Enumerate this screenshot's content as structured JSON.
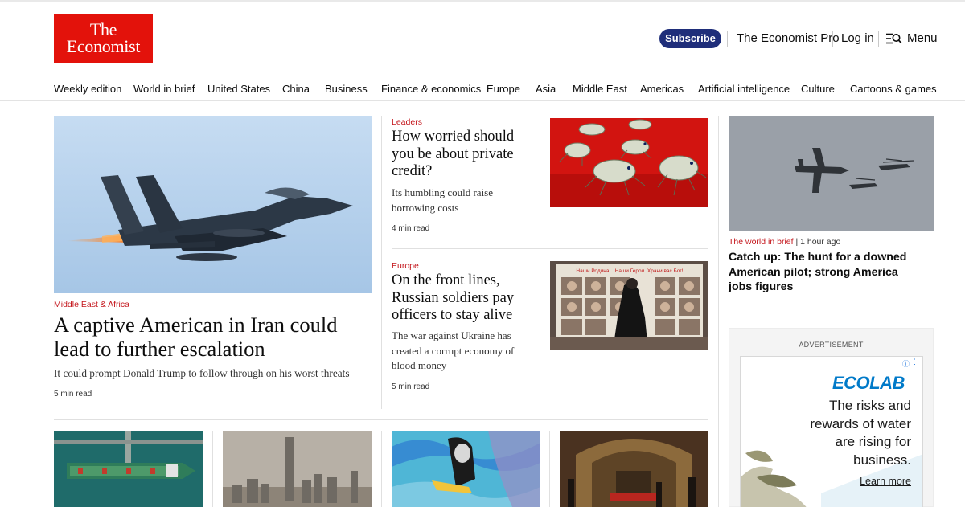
{
  "header": {
    "logo_line1": "The",
    "logo_line2": "Economist",
    "subscribe": "Subscribe",
    "pro": "The Economist Pro",
    "login": "Log in",
    "menu": "Menu"
  },
  "nav": [
    "Weekly edition",
    "World in brief",
    "United States",
    "China",
    "Business",
    "Finance & economics",
    "Europe",
    "Asia",
    "Middle East",
    "Americas",
    "Artificial intelligence",
    "Culture",
    "Cartoons & games"
  ],
  "lead": {
    "kicker": "Middle East & Africa",
    "headline_line1": "A captive American in Iran could",
    "headline_line2": "lead to further escalation",
    "dek": "It could prompt Donald Trump to follow through on his worst threats",
    "read": "5 min read"
  },
  "story2": {
    "kicker": "Leaders",
    "headline_line1": "How worried should",
    "headline_line2": "you be about private",
    "headline_line3": "credit?",
    "dek_line1": "Its humbling could raise",
    "dek_line2": "borrowing costs",
    "read": "4 min read"
  },
  "story3": {
    "kicker": "Europe",
    "headline_line1": "On the front lines,",
    "headline_line2": "Russian soldiers pay",
    "headline_line3": "officers to stay alive",
    "dek_line1": "The war against Ukraine has",
    "dek_line2": "created a corrupt economy of",
    "dek_line3": "blood money",
    "read": "5 min read",
    "billboard_text": "Наши Родина!.. Наши Герои. Храни вас Бог!"
  },
  "brief": {
    "kicker": "The world in brief",
    "time": "1 hour ago",
    "headline": "Catch up: The hunt for a downed American pilot; strong America jobs figures"
  },
  "ad": {
    "label": "ADVERTISEMENT",
    "brand": "ECOLAB",
    "text": "The risks and rewards of water are rising for business.",
    "cta": "Learn more"
  },
  "colors": {
    "brand_red": "#e3120b",
    "kicker_red": "#c4161c",
    "subscribe_navy": "#1f2e7a",
    "ad_blue": "#007ac9"
  },
  "icons": [
    "search-menu-icon",
    "ad-info-icon"
  ]
}
